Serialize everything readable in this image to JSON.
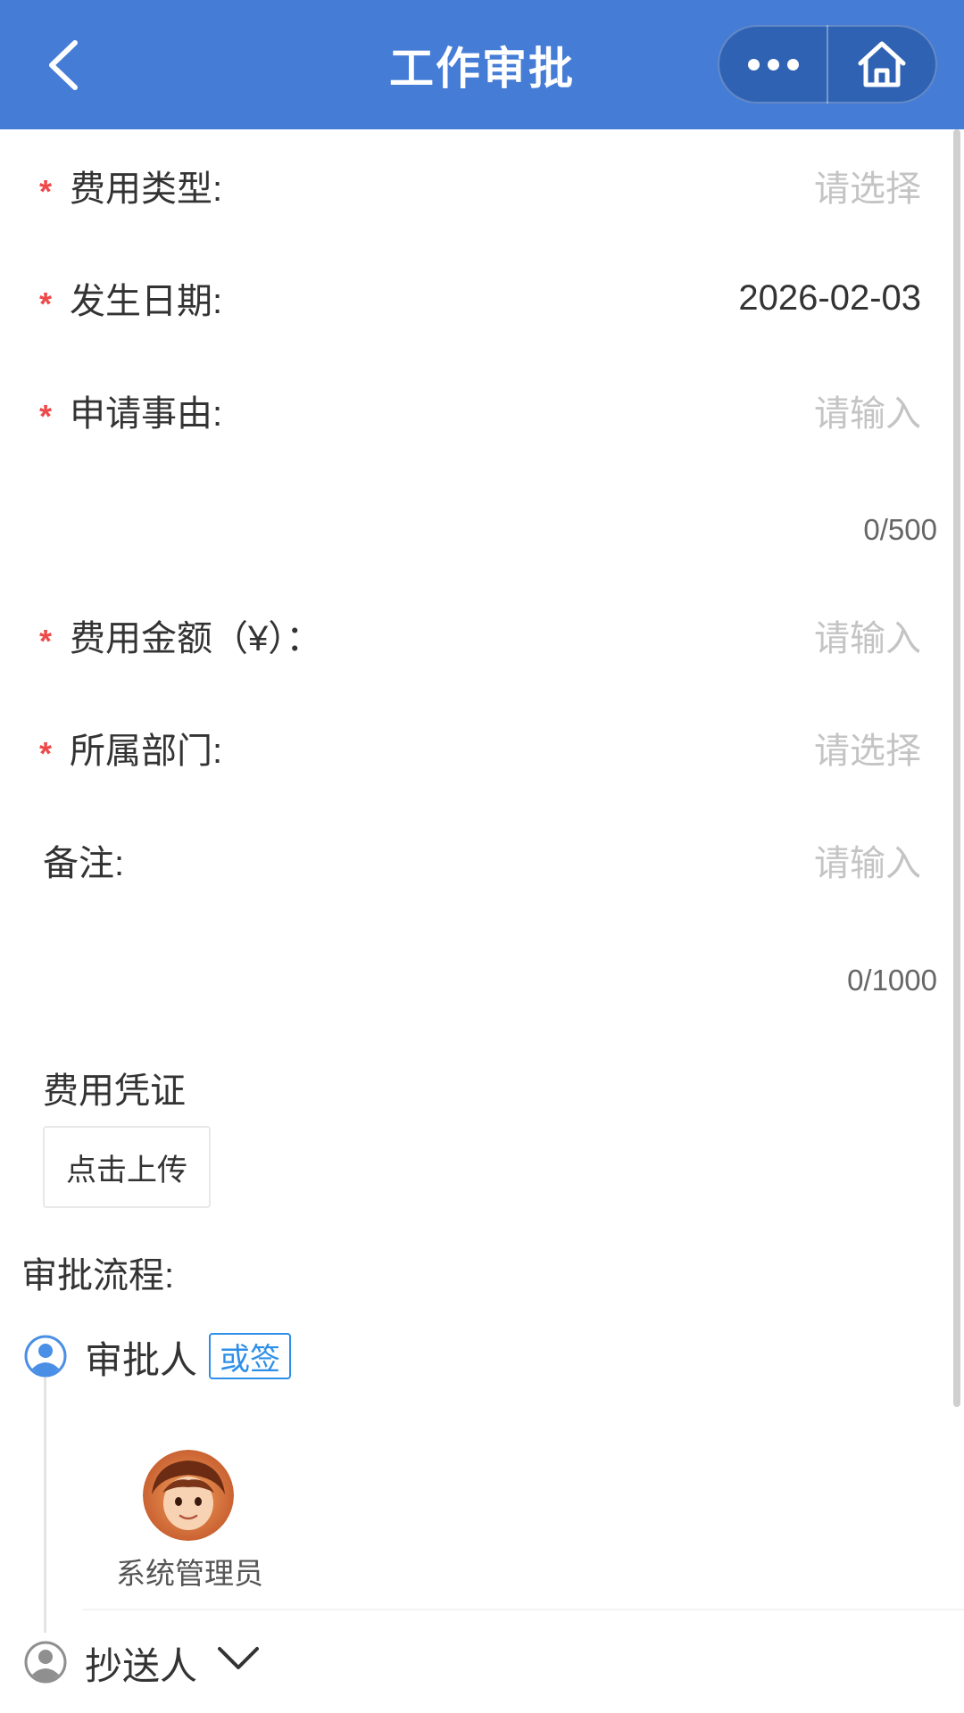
{
  "header": {
    "title": "工作审批",
    "back_icon": "chevron-left-icon",
    "more_icon": "more-dots-icon",
    "home_icon": "home-icon",
    "bg_color": "#457cd6"
  },
  "form": {
    "expense_type": {
      "label": "费用类型:",
      "placeholder": "请选择",
      "required": true
    },
    "date": {
      "label": "发生日期:",
      "value": "2026-02-03",
      "required": true
    },
    "reason": {
      "label": "申请事由:",
      "placeholder": "请输入",
      "counter": "0/500",
      "required": true
    },
    "amount": {
      "label": "费用金额（¥）：",
      "placeholder": "请输入",
      "required": true
    },
    "department": {
      "label": "所属部门:",
      "placeholder": "请选择",
      "required": true
    },
    "remark": {
      "label": "备注:",
      "placeholder": "请输入",
      "counter": "0/1000",
      "required": false
    },
    "voucher": {
      "label": "费用凭证",
      "upload_label": "点击上传"
    },
    "required_mark": "*"
  },
  "flow": {
    "title": "审批流程:",
    "approver": {
      "label": "审批人",
      "badge": "或签",
      "badge_color": "#2e8fe8",
      "icon": "user-circle-icon"
    },
    "approver_user": {
      "name": "系统管理员"
    },
    "cc": {
      "label": "抄送人",
      "icon": "user-circle-icon",
      "chevron": "chevron-down-icon"
    }
  }
}
